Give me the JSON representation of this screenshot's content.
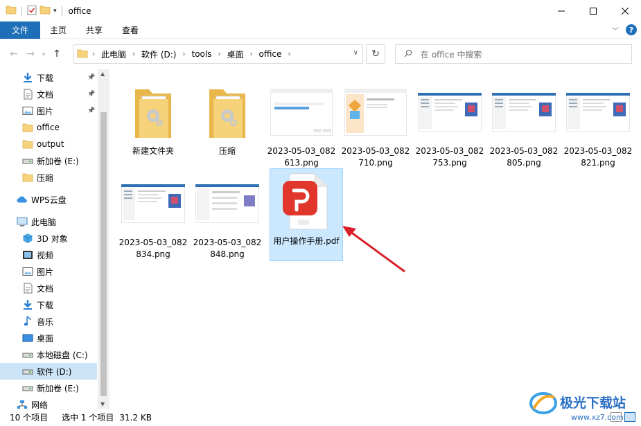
{
  "window": {
    "title": "office",
    "controls": {
      "minimize": "minimize-icon",
      "maximize": "maximize-icon",
      "close": "close-icon"
    }
  },
  "ribbon": {
    "tabs": [
      "文件",
      "主页",
      "共享",
      "查看"
    ],
    "help": "?"
  },
  "address": {
    "crumbs": [
      "此电脑",
      "软件 (D:)",
      "tools",
      "桌面",
      "office"
    ]
  },
  "search": {
    "placeholder": "在 office 中搜索"
  },
  "sidebar": {
    "quick": [
      {
        "label": "下载",
        "icon": "download-icon",
        "pinned": true
      },
      {
        "label": "文档",
        "icon": "document-icon",
        "pinned": true
      },
      {
        "label": "图片",
        "icon": "picture-icon",
        "pinned": true
      },
      {
        "label": "office",
        "icon": "folder-icon",
        "pinned": false
      },
      {
        "label": "output",
        "icon": "folder-icon",
        "pinned": false
      },
      {
        "label": "新加卷 (E:)",
        "icon": "drive-icon",
        "pinned": false
      },
      {
        "label": "压缩",
        "icon": "folder-icon",
        "pinned": false
      }
    ],
    "wps": "WPS云盘",
    "pc": "此电脑",
    "pc_items": [
      {
        "label": "3D 对象",
        "icon": "cube-icon"
      },
      {
        "label": "视频",
        "icon": "video-icon"
      },
      {
        "label": "图片",
        "icon": "picture-icon"
      },
      {
        "label": "文档",
        "icon": "document-icon"
      },
      {
        "label": "下载",
        "icon": "download-icon"
      },
      {
        "label": "音乐",
        "icon": "music-icon"
      },
      {
        "label": "桌面",
        "icon": "desktop-icon"
      },
      {
        "label": "本地磁盘 (C:)",
        "icon": "drive-icon"
      },
      {
        "label": "软件 (D:)",
        "icon": "drive-icon"
      },
      {
        "label": "新加卷 (E:)",
        "icon": "drive-icon"
      }
    ],
    "network": "网络",
    "selected": "软件 (D:)"
  },
  "files": [
    {
      "name": "新建文件夹",
      "kind": "folder"
    },
    {
      "name": "压缩",
      "kind": "folder"
    },
    {
      "name": "2023-05-03_082613.png",
      "kind": "png-dialog"
    },
    {
      "name": "2023-05-03_082710.png",
      "kind": "png-installer"
    },
    {
      "name": "2023-05-03_082753.png",
      "kind": "png-app"
    },
    {
      "name": "2023-05-03_082805.png",
      "kind": "png-app"
    },
    {
      "name": "2023-05-03_082821.png",
      "kind": "png-app"
    },
    {
      "name": "2023-05-03_082834.png",
      "kind": "png-app"
    },
    {
      "name": "2023-05-03_082848.png",
      "kind": "png-form"
    },
    {
      "name": "用户操作手册.pdf",
      "kind": "pdf",
      "selected": true
    }
  ],
  "status": {
    "count": "10 个项目",
    "selection": "选中 1 个项目",
    "size": "31.2 KB"
  },
  "watermark": {
    "text": "极光下载站",
    "url": "www.xz7.com"
  },
  "colors": {
    "accent": "#1e6fb8",
    "selection": "#cce8ff",
    "pdf_red": "#e0362c",
    "folder": "#f6d27a",
    "arrow": "#d9202a"
  }
}
